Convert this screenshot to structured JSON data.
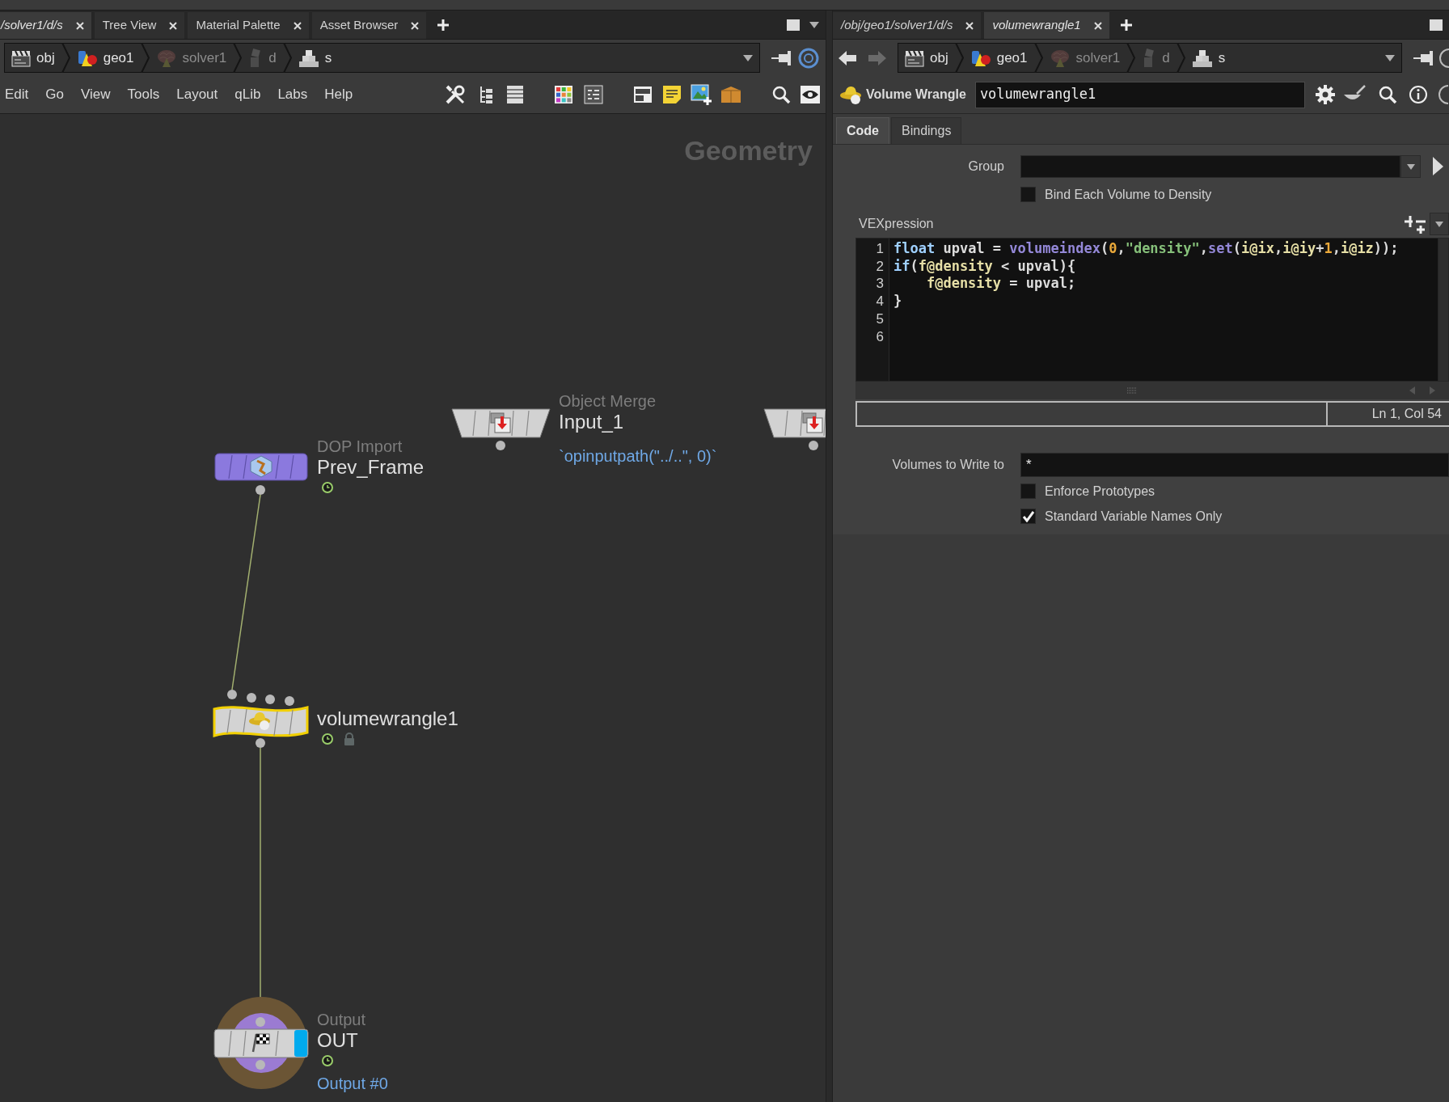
{
  "network_pane": {
    "tabs": [
      {
        "label": "/solver1/d/s",
        "selected": true,
        "linked": true
      },
      {
        "label": "Tree View",
        "selected": false,
        "linked": false
      },
      {
        "label": "Material Palette",
        "selected": false,
        "linked": false
      },
      {
        "label": "Asset Browser",
        "selected": false,
        "linked": false
      }
    ],
    "path": [
      {
        "label": "obj",
        "dimmed": false
      },
      {
        "label": "geo1",
        "dimmed": false
      },
      {
        "label": "solver1",
        "dimmed": true
      },
      {
        "label": "d",
        "dimmed": true
      },
      {
        "label": "s",
        "dimmed": false
      }
    ],
    "menu": [
      "Edit",
      "Go",
      "View",
      "Tools",
      "Layout",
      "qLib",
      "Labs",
      "Help"
    ],
    "network": {
      "context_label": "Geometry",
      "nodes": [
        {
          "kind": "object_merge",
          "type_label": "Object Merge",
          "name": "Input_1",
          "comment": "`opinputpath(\"../..\", 0)`",
          "selected": false,
          "time_dependent": false,
          "locked": false,
          "display_flag": false
        },
        {
          "kind": "object_merge",
          "selected": false,
          "time_dependent": false,
          "locked": false,
          "display_flag": false
        },
        {
          "kind": "dop_import",
          "type_label": "DOP Import",
          "name": "Prev_Frame",
          "selected": false,
          "time_dependent": true,
          "locked": false,
          "display_flag": false
        },
        {
          "kind": "wrangle",
          "name": "volumewrangle1",
          "selected": true,
          "time_dependent": true,
          "locked": true,
          "display_flag": false
        },
        {
          "kind": "output",
          "type_label": "Output",
          "name": "OUT",
          "comment": "Output #0",
          "selected": false,
          "time_dependent": true,
          "locked": false,
          "display_flag": true
        }
      ]
    }
  },
  "parameter_pane": {
    "tabs": [
      {
        "label": "/obj/geo1/solver1/d/s",
        "selected": false,
        "linked": true
      },
      {
        "label": "volumewrangle1",
        "selected": true,
        "linked": true
      }
    ],
    "history": [
      {
        "kind": "back",
        "disabled": false
      },
      {
        "kind": "forward",
        "disabled": true
      }
    ],
    "path": [
      {
        "label": "obj",
        "dimmed": false
      },
      {
        "label": "geo1",
        "dimmed": false
      },
      {
        "label": "solver1",
        "dimmed": true
      },
      {
        "label": "d",
        "dimmed": true
      },
      {
        "label": "s",
        "dimmed": false
      }
    ],
    "node_type": "Volume Wrangle",
    "node_name": "volumewrangle1",
    "sections": [
      {
        "label": "Code",
        "selected": true
      },
      {
        "label": "Bindings",
        "selected": false
      }
    ],
    "parameters": [
      {
        "kind": "menu_field",
        "label": "Group"
      },
      {
        "kind": "checkbox",
        "label": "Bind Each Volume to Density",
        "checked": false
      },
      {
        "kind": "code",
        "label": "VEXpression",
        "cursor_status": "Ln 1, Col 54",
        "lines": [
          {
            "number": "1",
            "tokens": [
              {
                "text": "float",
                "kind": "keyword"
              },
              {
                "text": " upval = ",
                "kind": "plain"
              },
              {
                "text": "volumeindex",
                "kind": "function"
              },
              {
                "text": "(",
                "kind": "plain"
              },
              {
                "text": "0",
                "kind": "number"
              },
              {
                "text": ",",
                "kind": "plain"
              },
              {
                "text": "\"density\"",
                "kind": "string"
              },
              {
                "text": ",",
                "kind": "plain"
              },
              {
                "text": "set",
                "kind": "function"
              },
              {
                "text": "(",
                "kind": "plain"
              },
              {
                "text": "i@ix",
                "kind": "attribute"
              },
              {
                "text": ",",
                "kind": "plain"
              },
              {
                "text": "i@iy",
                "kind": "attribute"
              },
              {
                "text": "+",
                "kind": "plain"
              },
              {
                "text": "1",
                "kind": "number"
              },
              {
                "text": ",",
                "kind": "plain"
              },
              {
                "text": "i@iz",
                "kind": "attribute"
              },
              {
                "text": "));",
                "kind": "plain"
              }
            ]
          },
          {
            "number": "2",
            "tokens": [
              {
                "text": "if",
                "kind": "keyword"
              },
              {
                "text": "(",
                "kind": "plain"
              },
              {
                "text": "f@density",
                "kind": "attribute"
              },
              {
                "text": " < upval){",
                "kind": "plain"
              }
            ]
          },
          {
            "number": "3",
            "tokens": [
              {
                "text": "    f@density",
                "kind": "attribute"
              },
              {
                "text": " = upval;",
                "kind": "plain"
              }
            ]
          },
          {
            "number": "4",
            "tokens": [
              {
                "text": "}",
                "kind": "plain"
              }
            ]
          },
          {
            "number": "5"
          },
          {
            "number": "6"
          }
        ]
      },
      {
        "kind": "text_field",
        "label": "Volumes to Write to",
        "value": "*"
      },
      {
        "kind": "checkbox",
        "label": "Enforce Prototypes",
        "checked": false
      },
      {
        "kind": "checkbox",
        "label": "Standard Variable Names Only",
        "checked": true
      }
    ]
  }
}
